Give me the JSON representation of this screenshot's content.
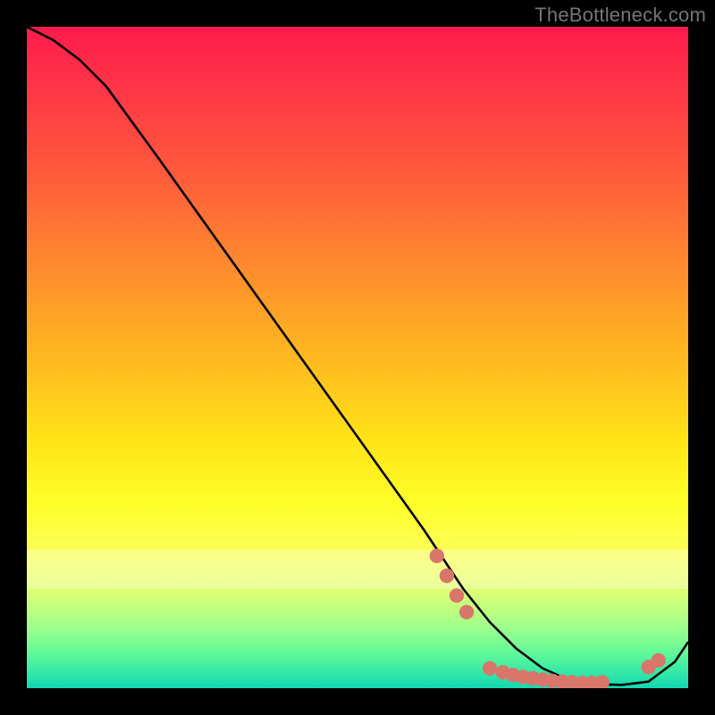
{
  "attribution": "TheBottleneck.com",
  "chart_data": {
    "type": "line",
    "title": "",
    "xlabel": "",
    "ylabel": "",
    "xlim": [
      0,
      100
    ],
    "ylim": [
      0,
      100
    ],
    "series": [
      {
        "name": "curve",
        "x": [
          0,
          4,
          8,
          12,
          20,
          30,
          40,
          50,
          60,
          66,
          70,
          74,
          78,
          82,
          86,
          90,
          94,
          98,
          100
        ],
        "y": [
          100,
          98,
          95,
          91,
          80,
          66,
          52,
          38,
          24,
          15,
          10,
          6,
          3,
          1.2,
          0.6,
          0.5,
          1.0,
          4,
          7
        ]
      }
    ],
    "markers": [
      {
        "x": 62,
        "y": 20
      },
      {
        "x": 63.5,
        "y": 17
      },
      {
        "x": 65,
        "y": 14
      },
      {
        "x": 66.5,
        "y": 11.5
      },
      {
        "x": 70,
        "y": 3.0
      },
      {
        "x": 72,
        "y": 2.4
      },
      {
        "x": 73.5,
        "y": 2.0
      },
      {
        "x": 75,
        "y": 1.7
      },
      {
        "x": 76.5,
        "y": 1.5
      },
      {
        "x": 78,
        "y": 1.3
      },
      {
        "x": 79.5,
        "y": 1.1
      },
      {
        "x": 81,
        "y": 1.0
      },
      {
        "x": 82.5,
        "y": 0.9
      },
      {
        "x": 84,
        "y": 0.8
      },
      {
        "x": 85.5,
        "y": 0.8
      },
      {
        "x": 87,
        "y": 0.9
      },
      {
        "x": 94,
        "y": 3.2
      },
      {
        "x": 95.5,
        "y": 4.2
      }
    ],
    "colors": {
      "curve": "#000000",
      "marker_fill": "#d9766c",
      "gradient_top": "#ff1a4d",
      "gradient_bottom": "#14d7b0"
    }
  }
}
